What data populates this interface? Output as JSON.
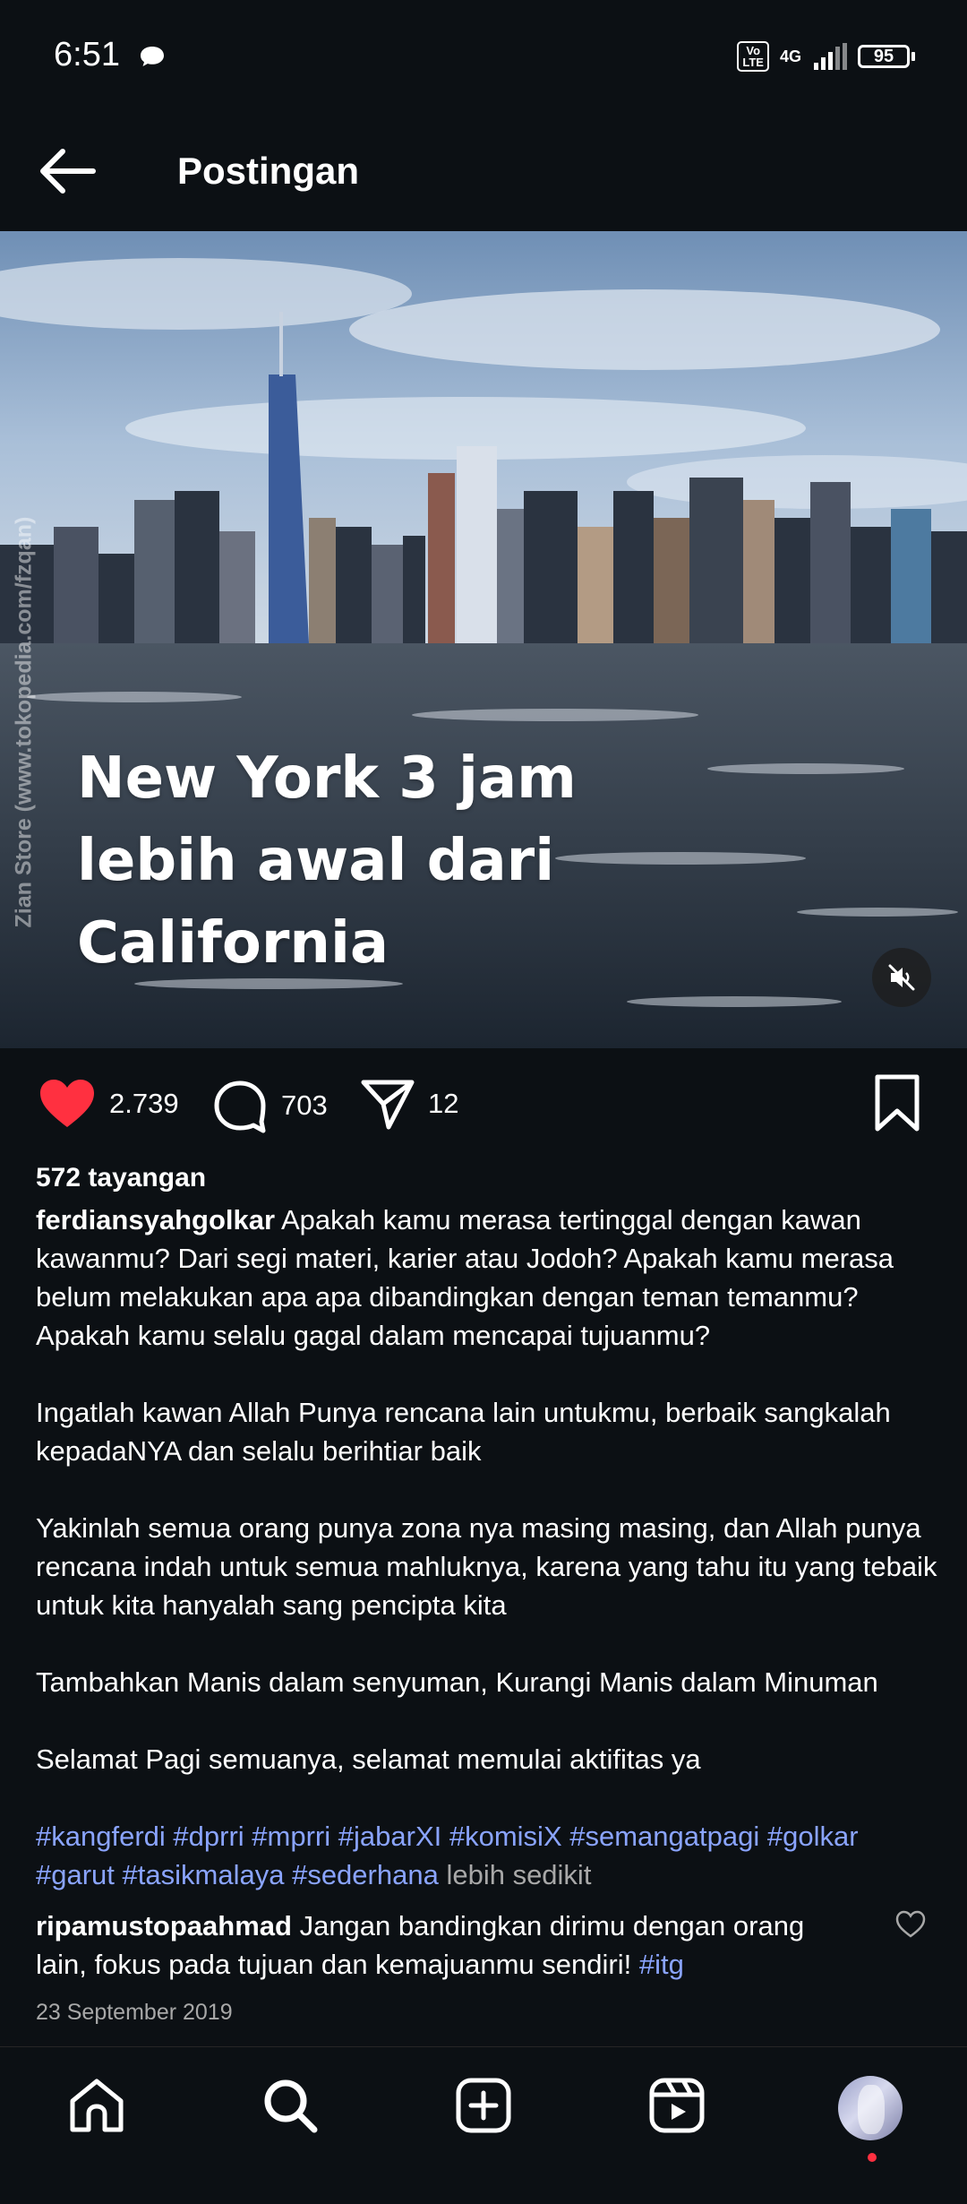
{
  "status_bar": {
    "time": "6:51",
    "volte": "Vo LTE",
    "network": "4G",
    "battery": "95"
  },
  "header": {
    "title": "Postingan"
  },
  "media": {
    "overlay_text": "New York 3 jam\nlebih awal dari\nCalifornia",
    "watermark": "Zian Store (www.tokopedia.com/fzqan)"
  },
  "actions": {
    "likes": "2.739",
    "comments": "703",
    "shares": "12"
  },
  "views": "572 tayangan",
  "post": {
    "username": "ferdiansyahgolkar",
    "paragraph1": "Apakah kamu merasa tertinggal dengan kawan kawanmu? Dari segi materi, karier atau Jodoh? Apakah kamu merasa belum melakukan apa apa dibandingkan dengan teman temanmu? Apakah kamu selalu gagal dalam mencapai tujuanmu?",
    "paragraph2": "Ingatlah kawan Allah Punya rencana lain untukmu, berbaik sangkalah kepadaNYA dan selalu berihtiar baik",
    "paragraph3": "Yakinlah semua orang punya zona nya masing masing, dan Allah punya rencana indah untuk semua mahluknya, karena yang tahu itu yang tebaik untuk kita hanyalah sang pencipta kita",
    "paragraph4": "Tambahkan Manis dalam senyuman, Kurangi Manis dalam Minuman",
    "paragraph5": "Selamat Pagi semuanya, selamat memulai aktifitas ya",
    "hashtags": [
      "#kangferdi",
      "#dprri",
      "#mprri",
      "#jabarXI",
      "#komisiX",
      "#semangatpagi",
      "#golkar",
      "#garut",
      "#tasikmalaya",
      "#sederhana"
    ],
    "more_label": "lebih sedikit",
    "date": "23 September 2019"
  },
  "top_comment": {
    "username": "ripamustopaahmad",
    "text": "Jangan bandingkan dirimu dengan orang lain, fokus pada tujuan dan kemajuanmu sendiri!",
    "hashtag": "#itg"
  },
  "bottom_nav": [
    "home-icon",
    "search-icon",
    "create-icon",
    "reels-icon",
    "profile-avatar"
  ],
  "colors": {
    "background": "#0c1014",
    "like_red": "#ff3040",
    "hashtag_blue": "#8aa4ff",
    "muted_gray": "#a8a8a8"
  }
}
